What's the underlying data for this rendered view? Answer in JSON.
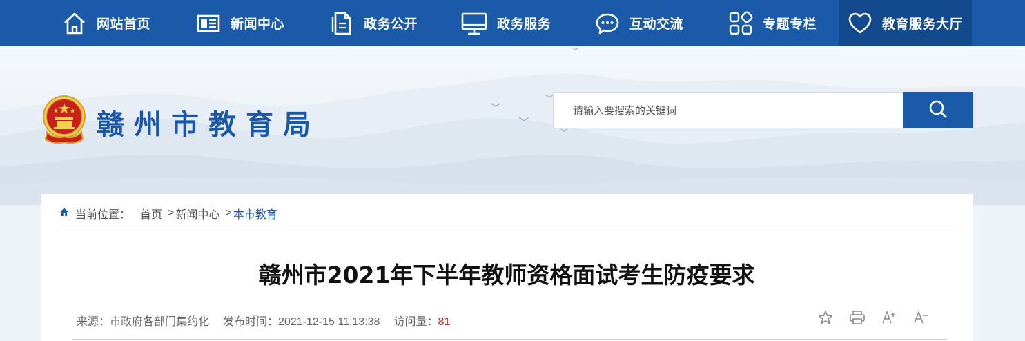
{
  "nav": {
    "items": [
      {
        "label": "网站首页",
        "icon": "home-icon"
      },
      {
        "label": "新闻中心",
        "icon": "newspaper-icon"
      },
      {
        "label": "政务公开",
        "icon": "document-icon"
      },
      {
        "label": "政务服务",
        "icon": "monitor-icon"
      },
      {
        "label": "互动交流",
        "icon": "chat-bubble-icon"
      },
      {
        "label": "专题专栏",
        "icon": "grid-icon"
      },
      {
        "label": "教育服务大厅",
        "icon": "heart-icon"
      }
    ],
    "active_index": 6
  },
  "header": {
    "site_title": "赣州市教育局",
    "emblem": "national-emblem-icon",
    "search_placeholder": "请输入要搜索的关键词"
  },
  "breadcrumb": {
    "prefix": "当前位置：",
    "items": [
      "首页",
      "新闻中心",
      "本市教育"
    ],
    "separator": ">"
  },
  "article": {
    "title": "赣州市2021年下半年教师资格面试考生防疫要求",
    "source_label": "来源：",
    "source": "市政府各部门集约化",
    "published_label": "发布时间：",
    "published": "2021-12-15 11:13:38",
    "views_label": "访问量：",
    "views": "81"
  },
  "tools": [
    {
      "name": "favorite-star-icon",
      "text": ""
    },
    {
      "name": "print-icon",
      "text": ""
    },
    {
      "name": "font-increase-button",
      "text": "A+"
    },
    {
      "name": "font-decrease-button",
      "text": "A-"
    }
  ],
  "colors": {
    "nav_bg": "#1a5aa8",
    "nav_active_bg": "#134a8e",
    "title_blue": "#1a57a6",
    "views_red": "#b1271d"
  }
}
